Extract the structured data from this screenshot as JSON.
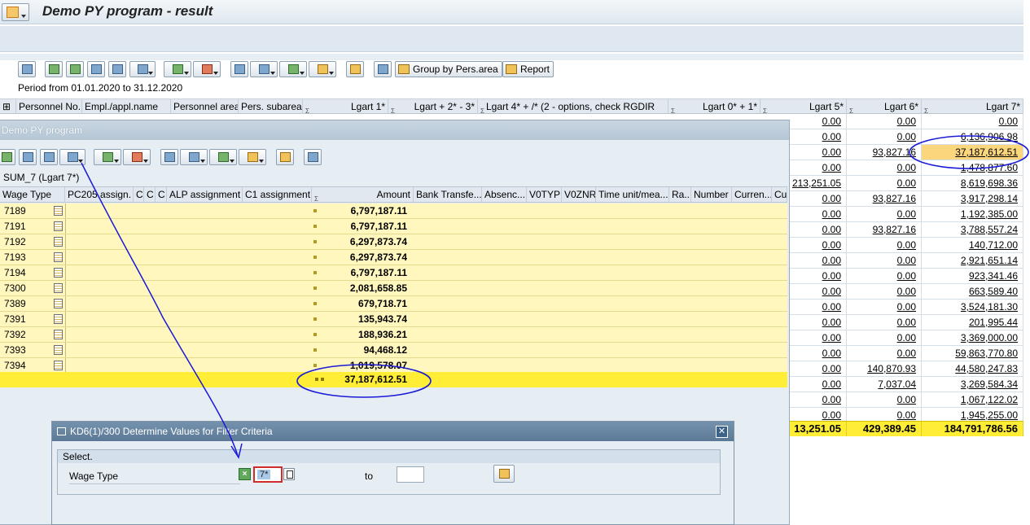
{
  "window": {
    "title": "Demo PY program - result"
  },
  "toolbar": {
    "group_button_label": "Group by Pers.area",
    "report_button_label": "Report"
  },
  "period_text": "Period from 01.01.2020 to 31.12.2020",
  "main_grid": {
    "columns": [
      "Personnel No.",
      "Empl./appl.name",
      "Personnel area",
      "Pers. subarea",
      "Lgart 1*",
      "Lgart + 2* - 3*",
      "Lgart 4* + /* (2 - options, check RGDIR",
      "Lgart 0* + 1*",
      "Lgart 5*",
      "Lgart 6*",
      "Lgart 7*"
    ],
    "rows": [
      {
        "lgart5": "0.00",
        "lgart6": "0.00",
        "lgart7": "0.00"
      },
      {
        "lgart5": "0.00",
        "lgart6": "0.00",
        "lgart7": "6,136,906.98"
      },
      {
        "lgart5": "0.00",
        "lgart6": "93,827.16",
        "lgart7": "37,187,612.51"
      },
      {
        "lgart5": "0.00",
        "lgart6": "0.00",
        "lgart7": "1,478,877.60"
      },
      {
        "lgart5": "213,251.05",
        "lgart6": "0.00",
        "lgart7": "8,619,698.36"
      },
      {
        "lgart5": "0.00",
        "lgart6": "93,827.16",
        "lgart7": "3,917,298.14"
      },
      {
        "lgart5": "0.00",
        "lgart6": "0.00",
        "lgart7": "1,192,385.00"
      },
      {
        "lgart5": "0.00",
        "lgart6": "93,827.16",
        "lgart7": "3,788,557.24"
      },
      {
        "lgart5": "0.00",
        "lgart6": "0.00",
        "lgart7": "140,712.00"
      },
      {
        "lgart5": "0.00",
        "lgart6": "0.00",
        "lgart7": "2,921,651.14"
      },
      {
        "lgart5": "0.00",
        "lgart6": "0.00",
        "lgart7": "923,341.46"
      },
      {
        "lgart5": "0.00",
        "lgart6": "0.00",
        "lgart7": "663,589.40"
      },
      {
        "lgart5": "0.00",
        "lgart6": "0.00",
        "lgart7": "3,524,181.30"
      },
      {
        "lgart5": "0.00",
        "lgart6": "0.00",
        "lgart7": "201,995.44"
      },
      {
        "lgart5": "0.00",
        "lgart6": "0.00",
        "lgart7": "3,369,000.00"
      },
      {
        "lgart5": "0.00",
        "lgart6": "0.00",
        "lgart7": "59,863,770.80"
      },
      {
        "lgart5": "0.00",
        "lgart6": "140,870.93",
        "lgart7": "44,580,247.83"
      },
      {
        "lgart5": "0.00",
        "lgart6": "7,037.04",
        "lgart7": "3,269,584.34"
      },
      {
        "lgart5": "0.00",
        "lgart6": "0.00",
        "lgart7": "1,067,122.02"
      },
      {
        "lgart5": "0.00",
        "lgart6": "0.00",
        "lgart7": "1,945,255.00"
      }
    ],
    "totals": {
      "lgart5": "13,251.05",
      "lgart6": "429,389.45",
      "lgart7": "184,791,786.56"
    }
  },
  "popup1": {
    "title": "Demo PY program",
    "subtitle": "SUM_7 (Lgart 7*)",
    "columns": [
      "Wage Type",
      "PC205 assign.",
      "C",
      "C",
      "C",
      "ALP assignment",
      "C1 assignment",
      "Amount",
      "Bank Transfe...",
      "Absenc...",
      "V0TYP",
      "V0ZNR",
      "Time unit/mea...",
      "Ra...",
      "Number",
      "Curren...",
      "Cu"
    ],
    "rows": [
      {
        "wage_type": "7189",
        "amount": "6,797,187.11"
      },
      {
        "wage_type": "7191",
        "amount": "6,797,187.11"
      },
      {
        "wage_type": "7192",
        "amount": "6,297,873.74"
      },
      {
        "wage_type": "7193",
        "amount": "6,297,873.74"
      },
      {
        "wage_type": "7194",
        "amount": "6,797,187.11"
      },
      {
        "wage_type": "7300",
        "amount": "2,081,658.85"
      },
      {
        "wage_type": "7389",
        "amount": "679,718.71"
      },
      {
        "wage_type": "7391",
        "amount": "135,943.74"
      },
      {
        "wage_type": "7392",
        "amount": "188,936.21"
      },
      {
        "wage_type": "7393",
        "amount": "94,468.12"
      },
      {
        "wage_type": "7394",
        "amount": "1,019,578.07"
      }
    ],
    "total_amount": "37,187,612.51"
  },
  "popup2": {
    "title": "KD6(1)/300 Determine Values for Filter Criteria",
    "section_label": "Select.",
    "field_label": "Wage Type",
    "from_value": "7*",
    "to_label": "to",
    "to_value": ""
  },
  "colors": {
    "highlight": "#fbd67d",
    "total_row": "#ffee35",
    "annotation": "#1a1ad6"
  }
}
